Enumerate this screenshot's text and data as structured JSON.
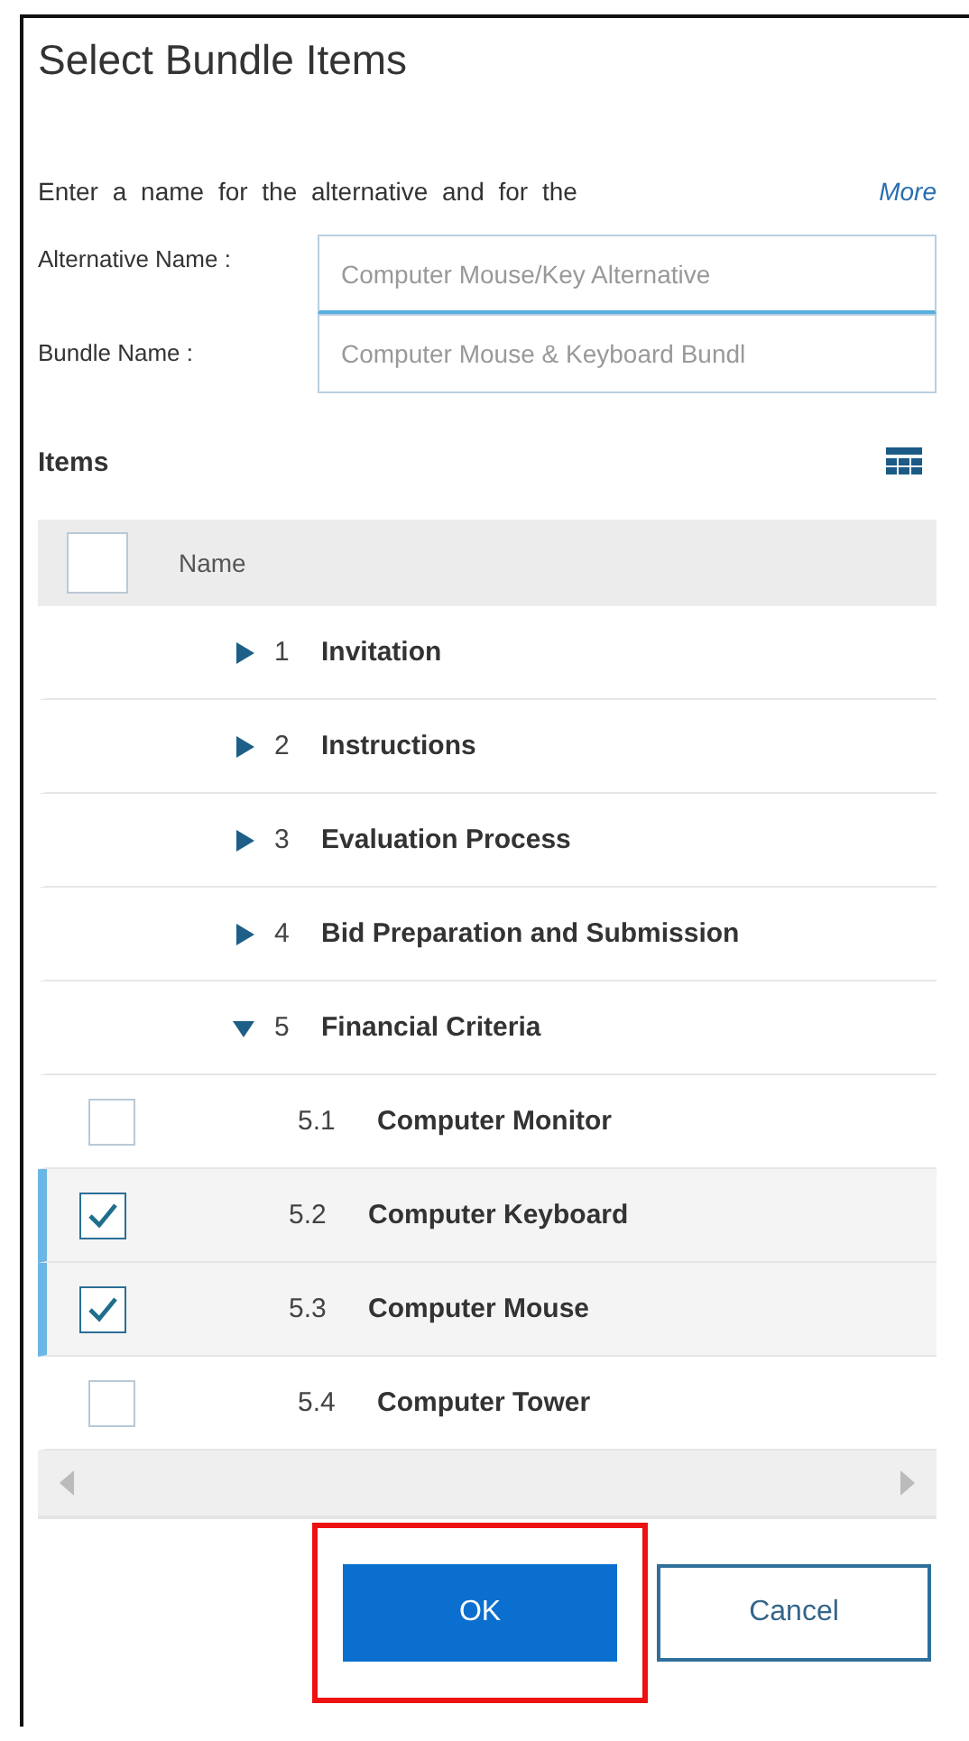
{
  "dialog": {
    "title": "Select Bundle Items",
    "description": "Enter a name for the alternative and for the",
    "more_link": "More"
  },
  "fields": [
    {
      "label": "Alternative Name :",
      "placeholder": "Computer Mouse/Key Alternative",
      "focused": true
    },
    {
      "label": "Bundle Name :",
      "placeholder": "Computer Mouse & Keyboard Bundl",
      "focused": false
    }
  ],
  "items": {
    "title": "Items",
    "header": {
      "column": "Name",
      "checked": false
    },
    "rows": [
      {
        "number": "1",
        "label": "Invitation",
        "expanded": false
      },
      {
        "number": "2",
        "label": "Instructions",
        "expanded": false
      },
      {
        "number": "3",
        "label": "Evaluation Process",
        "expanded": false
      },
      {
        "number": "4",
        "label": "Bid Preparation and Submission",
        "expanded": false
      },
      {
        "number": "5",
        "label": "Financial Criteria",
        "expanded": true,
        "children": [
          {
            "number": "5.1",
            "label": "Computer Monitor",
            "checked": false,
            "selected": false
          },
          {
            "number": "5.2",
            "label": "Computer Keyboard",
            "checked": true,
            "selected": true
          },
          {
            "number": "5.3",
            "label": "Computer Mouse",
            "checked": true,
            "selected": true
          },
          {
            "number": "5.4",
            "label": "Computer Tower",
            "checked": false,
            "selected": false
          }
        ]
      }
    ]
  },
  "buttons": [
    {
      "label": "OK",
      "kind": "primary",
      "highlighted": true
    },
    {
      "label": "Cancel",
      "kind": "secondary",
      "highlighted": false
    }
  ]
}
